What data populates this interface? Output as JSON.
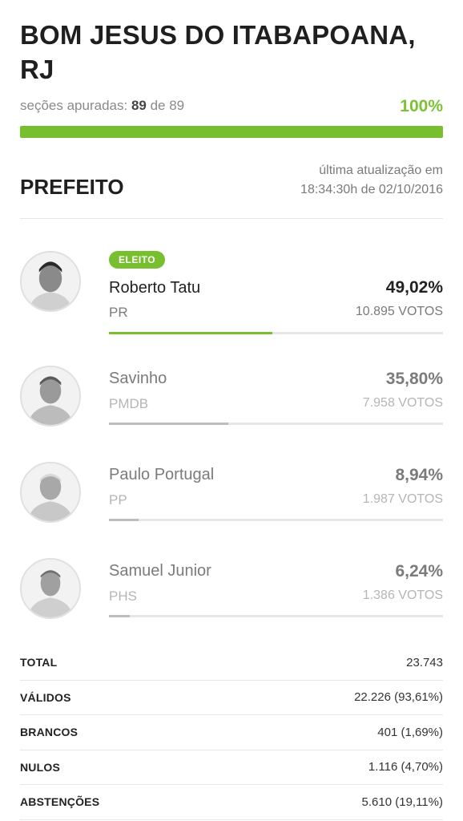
{
  "header": {
    "city": "BOM JESUS DO ITABAPOANA, RJ",
    "sections_prefix": "seções apuradas:",
    "sections_done": "89",
    "sections_of": "de 89",
    "percent_counted": "100%",
    "progress_fraction": 1.0
  },
  "race": {
    "office": "PREFEITO",
    "updated_label": "última atualização em",
    "updated_time": "18:34:30h de 02/10/2016"
  },
  "candidates": [
    {
      "name": "Roberto Tatu",
      "party": "PR",
      "percent": "49,02%",
      "votes": "10.895 VOTOS",
      "elected": true,
      "badge": "ELEITO",
      "share": 0.4902
    },
    {
      "name": "Savinho",
      "party": "PMDB",
      "percent": "35,80%",
      "votes": "7.958 VOTOS",
      "elected": false,
      "share": 0.358
    },
    {
      "name": "Paulo Portugal",
      "party": "PP",
      "percent": "8,94%",
      "votes": "1.987 VOTOS",
      "elected": false,
      "share": 0.0894
    },
    {
      "name": "Samuel Junior",
      "party": "PHS",
      "percent": "6,24%",
      "votes": "1.386 VOTOS",
      "elected": false,
      "share": 0.0624
    }
  ],
  "totals": [
    {
      "label": "TOTAL",
      "value": "23.743"
    },
    {
      "label": "VÁLIDOS",
      "value": "22.226 (93,61%)"
    },
    {
      "label": "BRANCOS",
      "value": "401 (1,69%)"
    },
    {
      "label": "NULOS",
      "value": "1.116 (4,70%)"
    },
    {
      "label": "ABSTENÇÕES",
      "value": "5.610 (19,11%)"
    }
  ],
  "colors": {
    "accent": "#77bf2e",
    "other_bar": "#bdbdbd",
    "text_dark": "#1f1f1f"
  }
}
